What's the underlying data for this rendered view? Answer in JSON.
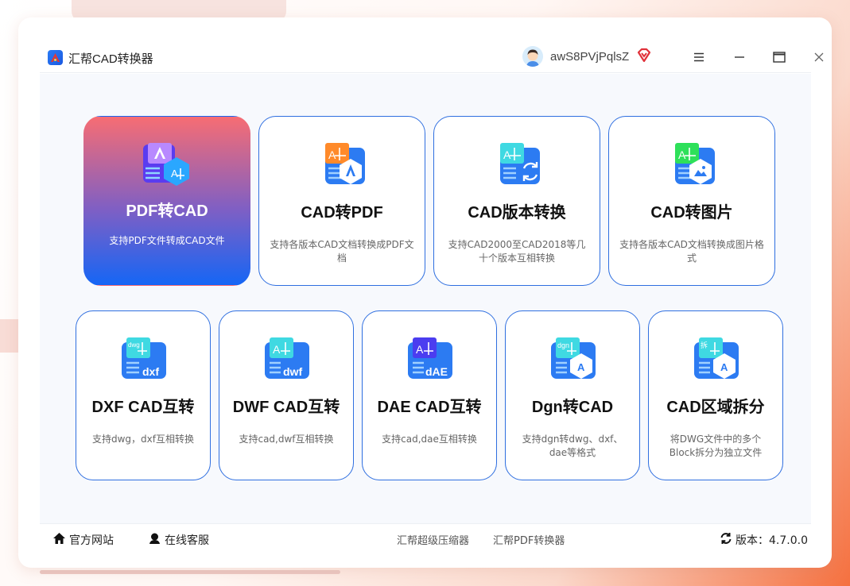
{
  "app": {
    "title": "汇帮CAD转换器"
  },
  "user": {
    "name": "awS8PVjPqlsZ"
  },
  "icons": {
    "app_logo": "cad-logo-icon",
    "vip": "diamond-icon",
    "menu": "hamburger-icon",
    "minimize": "minimize-icon",
    "maximize": "maximize-icon",
    "close": "close-icon",
    "home": "home-icon",
    "service": "headset-icon",
    "refresh": "refresh-icon"
  },
  "colors": {
    "accent": "#1566f5",
    "active_gradient_top": "#f76d73",
    "card_border": "#2f6fe0",
    "vip": "#e0313a"
  },
  "tools": [
    {
      "title": "PDF转CAD",
      "desc": "支持PDF文件转成CAD文件",
      "active": true,
      "icon": "pdf-to-cad-icon"
    },
    {
      "title": "CAD转PDF",
      "desc": "支持各版本CAD文档转换成PDF文档",
      "icon": "cad-to-pdf-icon"
    },
    {
      "title": "CAD版本转换",
      "desc": "支持CAD2000至CAD2018等几十个版本互相转换",
      "icon": "cad-version-convert-icon"
    },
    {
      "title": "CAD转图片",
      "desc": "支持各版本CAD文档转换成图片格式",
      "icon": "cad-to-image-icon"
    },
    {
      "title": "DXF CAD互转",
      "desc": "支持dwg，dxf互相转换",
      "icon": "dxf-icon",
      "badge": "dxf"
    },
    {
      "title": "DWF CAD互转",
      "desc": "支持cad,dwf互相转换",
      "icon": "dwf-icon",
      "badge": "dwf"
    },
    {
      "title": "DAE CAD互转",
      "desc": "支持cad,dae互相转换",
      "icon": "dae-icon",
      "badge": "dAE"
    },
    {
      "title": "Dgn转CAD",
      "desc": "支持dgn转dwg、dxf、dae等格式",
      "icon": "dgn-icon",
      "badge": "dgn"
    },
    {
      "title": "CAD区域拆分",
      "desc": "将DWG文件中的多个Block拆分为独立文件",
      "icon": "cad-split-icon",
      "badge": "拆"
    }
  ],
  "footer": {
    "website": "官方网站",
    "service": "在线客服",
    "link1": "汇帮超级压缩器",
    "link2": "汇帮PDF转换器",
    "version": "版本：4.7.0.0"
  }
}
